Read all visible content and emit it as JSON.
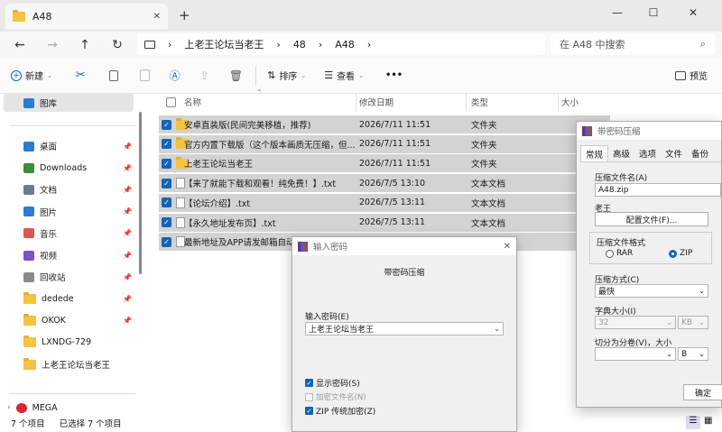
{
  "window": {
    "tab_title": "A48",
    "new_tab": "+",
    "tab_close": "✕",
    "min": "—",
    "max": "☐",
    "close": "✕"
  },
  "nav": {
    "back": "←",
    "forward": "→",
    "up": "↑",
    "refresh": "↻",
    "breadcrumb": [
      "上老王论坛当老王",
      "48",
      "A48"
    ],
    "sep": "›",
    "search_placeholder": "在 A48 中搜索"
  },
  "toolbar": {
    "new": "新建",
    "sort": "排序",
    "view": "查看",
    "more": "•••",
    "preview": "预览"
  },
  "sidebar": {
    "gallery": "图库",
    "items": [
      {
        "label": "桌面",
        "icon": "desktop-icon",
        "pinned": true
      },
      {
        "label": "Downloads",
        "icon": "download-icon",
        "pinned": true
      },
      {
        "label": "文档",
        "icon": "document-icon",
        "pinned": true
      },
      {
        "label": "图片",
        "icon": "picture-icon",
        "pinned": true
      },
      {
        "label": "音乐",
        "icon": "music-icon",
        "pinned": true
      },
      {
        "label": "视频",
        "icon": "video-icon",
        "pinned": true
      },
      {
        "label": "回收站",
        "icon": "recycle-bin-icon",
        "pinned": true
      },
      {
        "label": "dedede",
        "icon": "folder-icon",
        "pinned": true
      },
      {
        "label": "OKOK",
        "icon": "folder-icon",
        "pinned": true
      },
      {
        "label": "LXNDG-729",
        "icon": "folder-icon",
        "pinned": false
      },
      {
        "label": "上老王论坛当老王",
        "icon": "folder-icon",
        "pinned": false
      }
    ],
    "mega": "MEGA"
  },
  "columns": {
    "name": "名称",
    "date": "修改日期",
    "type": "类型",
    "size": "大小"
  },
  "files": [
    {
      "name": "安卓直装版(民间完美移植，推荐)",
      "date": "2026/7/11 11:51",
      "type": "文件夹",
      "kind": "folder"
    },
    {
      "name": "官方内置下载版（这个版本画质无压缩，但...",
      "date": "2026/7/11 11:51",
      "type": "文件夹",
      "kind": "folder"
    },
    {
      "name": "上老王论坛当老王",
      "date": "2026/7/11 11:51",
      "type": "文件夹",
      "kind": "folder"
    },
    {
      "name": "【来了就能下载和观看！纯免费！】.txt",
      "date": "2026/7/5 13:10",
      "type": "文本文档",
      "kind": "txt"
    },
    {
      "name": "【论坛介绍】.txt",
      "date": "2026/7/5 13:11",
      "type": "文本文档",
      "kind": "txt"
    },
    {
      "name": "【永久地址发布页】.txt",
      "date": "2026/7/5 13:11",
      "type": "文本文档",
      "kind": "txt"
    },
    {
      "name": "最新地址及APP请发邮箱自动获",
      "date": "",
      "type": "",
      "kind": "txt"
    }
  ],
  "status": {
    "count": "7 个项目",
    "selected": "已选择 7 个项目"
  },
  "password_dialog": {
    "title": "输入密码",
    "header": "带密码压缩",
    "label": "输入密码(E)",
    "value": "上老王论坛当老王",
    "show_password": "显示密码(S)",
    "encrypt_names": "加密文件名(N)",
    "zip_legacy": "ZIP 传统加密(Z)"
  },
  "compress_dialog": {
    "title": "带密码压缩",
    "tabs": [
      "常规",
      "高级",
      "选项",
      "文件",
      "备份"
    ],
    "archive_label": "压缩文件名(A)",
    "archive_value": "A48.zip",
    "profile_label": "老王",
    "profile_button": "配置文件(F)...",
    "format_label": "压缩文件格式",
    "rar": "RAR",
    "zip": "ZIP",
    "method_label": "压缩方式(C)",
    "method_value": "最快",
    "dict_label": "字典大小(I)",
    "dict_value": "32",
    "dict_unit": "KB",
    "split_label": "切分为分卷(V)，大小",
    "split_unit": "B",
    "ok": "确定"
  }
}
